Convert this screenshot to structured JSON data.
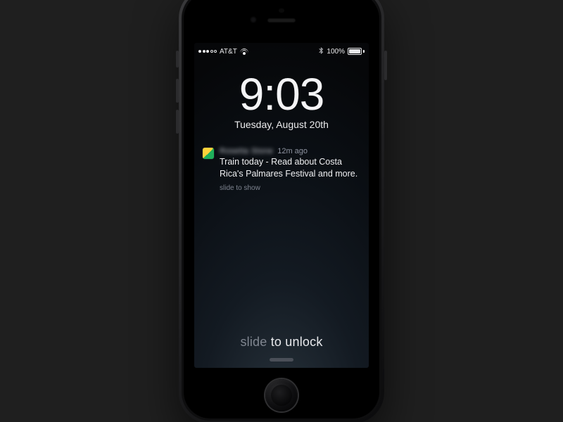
{
  "status": {
    "carrier": "AT&T",
    "signal_dots": 5,
    "signal_filled": 3,
    "battery_pct": "100%",
    "bluetooth_glyph": "ʙ",
    "bt": "*"
  },
  "clock": {
    "time": "9:03",
    "date": "Tuesday, August 20th"
  },
  "notification": {
    "app_name": "Rosetta Stone",
    "age": "12m ago",
    "message": "Train today - Read about Costa Rica's Palmares Festival and more.",
    "hint": "slide to show"
  },
  "unlock": {
    "dim": "slide ",
    "bright": "to unlock"
  }
}
